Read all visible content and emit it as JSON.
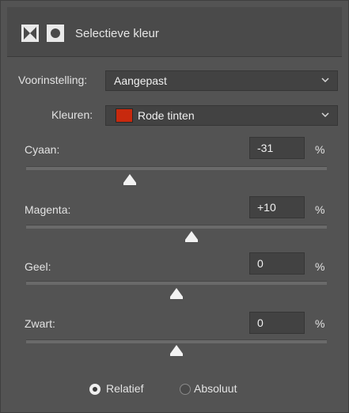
{
  "panel": {
    "title": "Selectieve kleur",
    "icons": [
      "adjustment-layer-icon",
      "mask-icon"
    ]
  },
  "preset": {
    "label": "Voorinstelling:",
    "value": "Aangepast"
  },
  "colors": {
    "label": "Kleuren:",
    "value": "Rode tinten",
    "swatch_color": "#c8290e"
  },
  "sliders": [
    {
      "label": "Cyaan:",
      "value": "-31",
      "unit": "%",
      "percent": -31
    },
    {
      "label": "Magenta:",
      "value": "+10",
      "unit": "%",
      "percent": 10
    },
    {
      "label": "Geel:",
      "value": "0",
      "unit": "%",
      "percent": 0
    },
    {
      "label": "Zwart:",
      "value": "0",
      "unit": "%",
      "percent": 0
    }
  ],
  "method": {
    "options": [
      {
        "label": "Relatief",
        "selected": true
      },
      {
        "label": "Absoluut",
        "selected": false
      }
    ]
  }
}
